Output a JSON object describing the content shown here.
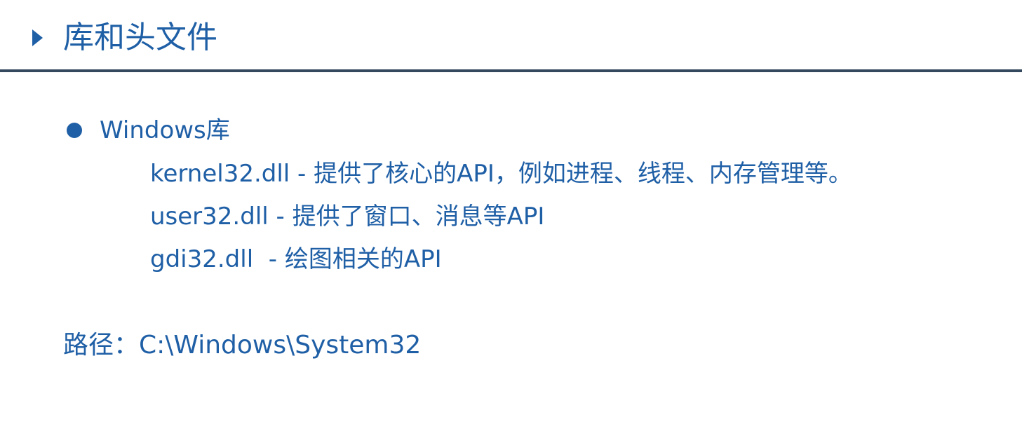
{
  "title": "库和头文件",
  "bullet": {
    "label": "Windows库",
    "libraries": [
      "kernel32.dll - 提供了核心的API，例如进程、线程、内存管理等。",
      "user32.dll - 提供了窗口、消息等API",
      "gdi32.dll  - 绘图相关的API"
    ]
  },
  "path_line": "路径：C:\\Windows\\System32",
  "colors": {
    "text": "#1f5fa6",
    "rule": "#34495e",
    "background": "#ffffff"
  },
  "icons": {
    "title_marker": "triangle-right-icon",
    "bullet_marker": "bullet-dot-icon"
  }
}
